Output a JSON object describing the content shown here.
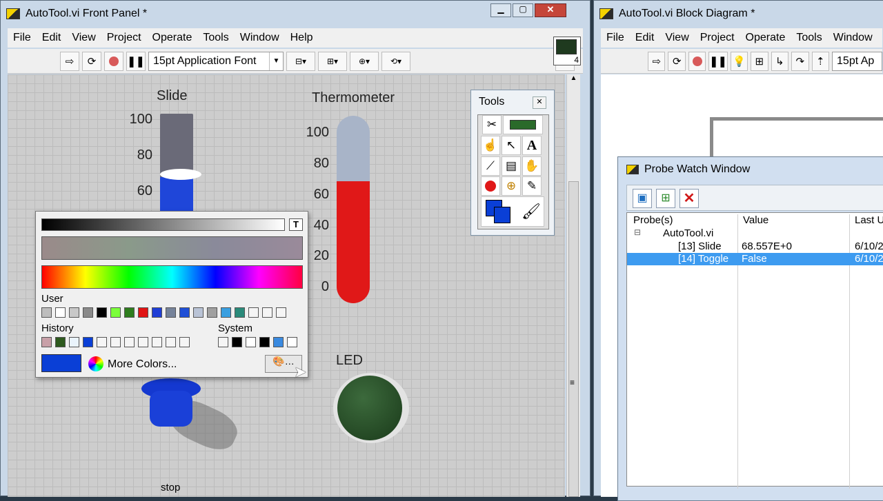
{
  "front_panel": {
    "title": "AutoTool.vi Front Panel *",
    "menu": [
      "File",
      "Edit",
      "View",
      "Project",
      "Operate",
      "Tools",
      "Window",
      "Help"
    ],
    "font_select": "15pt Application Font",
    "help_btn": "?",
    "conn_pane_num": "4"
  },
  "controls": {
    "slide_label": "Slide",
    "slide_ticks": [
      "100",
      "80",
      "60"
    ],
    "thermo_label": "Thermometer",
    "thermo_ticks": [
      "100",
      "80",
      "60",
      "40",
      "20",
      "0"
    ],
    "led_label": "LED",
    "stop_label": "stop"
  },
  "color_picker": {
    "t_btn": "T",
    "user_label": "User",
    "history_label": "History",
    "system_label": "System",
    "more_colors": "More Colors...",
    "user_colors": [
      "#bdbdbd",
      "#ffffff",
      "#c8c8c8",
      "#8a8a8a",
      "#000000",
      "#7bff3a",
      "#2e7d1e",
      "#e01414",
      "#1f3ed6",
      "#76839a",
      "#1f4fd6",
      "#b9c3d6",
      "#a0a0a0",
      "#3a9fe0",
      "#2a8a7a",
      "#f5f5f5",
      "#f5f5f5",
      "#f5f5f5"
    ],
    "history_colors": [
      "#c8a0a8",
      "#2e5a1e",
      "#eaf4fc",
      "#0a3fd6",
      "#f5f5f5",
      "#f5f5f5",
      "#f5f5f5",
      "#f5f5f5",
      "#f5f5f5",
      "#f5f5f5",
      "#f5f5f5"
    ],
    "system_colors": [
      "#f5f5f5",
      "#000000",
      "#ffffff",
      "#000000",
      "#3a8ae0",
      "#ffffff"
    ],
    "current_color": "#0a3fd6"
  },
  "tools": {
    "title": "Tools",
    "close": "✕"
  },
  "block_diagram": {
    "title": "AutoTool.vi Block Diagram *",
    "menu": [
      "File",
      "Edit",
      "View",
      "Project",
      "Operate",
      "Tools",
      "Window"
    ],
    "font_select": "15pt Ap"
  },
  "probe": {
    "title": "Probe Watch Window",
    "col_probes": "Probe(s)",
    "col_value": "Value",
    "col_last": "Last U",
    "expand": "⊟",
    "vi_name": "AutoTool.vi",
    "rows": [
      {
        "name": "[13] Slide",
        "value": "68.557E+0",
        "last": "6/10/2"
      },
      {
        "name": "[14] Toggle",
        "value": "False",
        "last": "6/10/2"
      }
    ]
  }
}
